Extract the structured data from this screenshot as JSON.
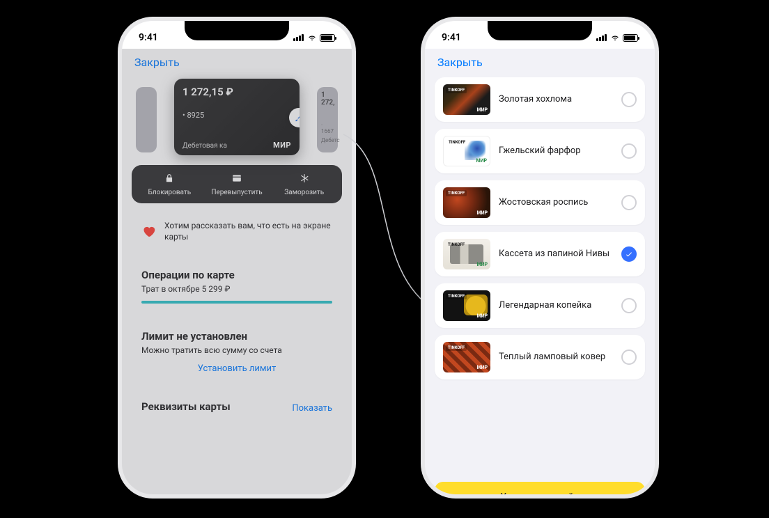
{
  "status": {
    "time": "9:41"
  },
  "left": {
    "close_label": "Закрыть",
    "card": {
      "balance": "1 272,15 ₽",
      "number": "• 8925",
      "type_label": "Дебетовая ка",
      "system": "МИР"
    },
    "peek_right": {
      "balance": "1 272,",
      "number": "· 1667",
      "type_label": "Дебетс"
    },
    "actions": {
      "block": "Блокировать",
      "reissue": "Перевыпустить",
      "freeze": "Заморозить"
    },
    "tip_text": "Хотим рассказать вам, что есть на экране карты",
    "ops": {
      "title": "Операции по карте",
      "subtitle": "Трат в октябре 5 299 ₽"
    },
    "limit": {
      "title": "Лимит не установлен",
      "subtitle": "Можно тратить всю сумму со счета",
      "set_button": "Установить лимит"
    },
    "details": {
      "title": "Реквизиты карты",
      "show": "Показать"
    }
  },
  "right": {
    "close_label": "Закрыть",
    "brand": "TINKOFF",
    "card_system": "МИР",
    "designs": [
      {
        "name": "Золотая хохлома",
        "selected": false
      },
      {
        "name": "Гжельский фарфор",
        "selected": false
      },
      {
        "name": "Жостовская роспись",
        "selected": false
      },
      {
        "name": "Кассета из папиной Нивы",
        "selected": true
      },
      {
        "name": "Легендарная копейка",
        "selected": false
      },
      {
        "name": "Теплый ламповый ковер",
        "selected": false
      }
    ],
    "cta": "Хочу этот дизайн"
  }
}
